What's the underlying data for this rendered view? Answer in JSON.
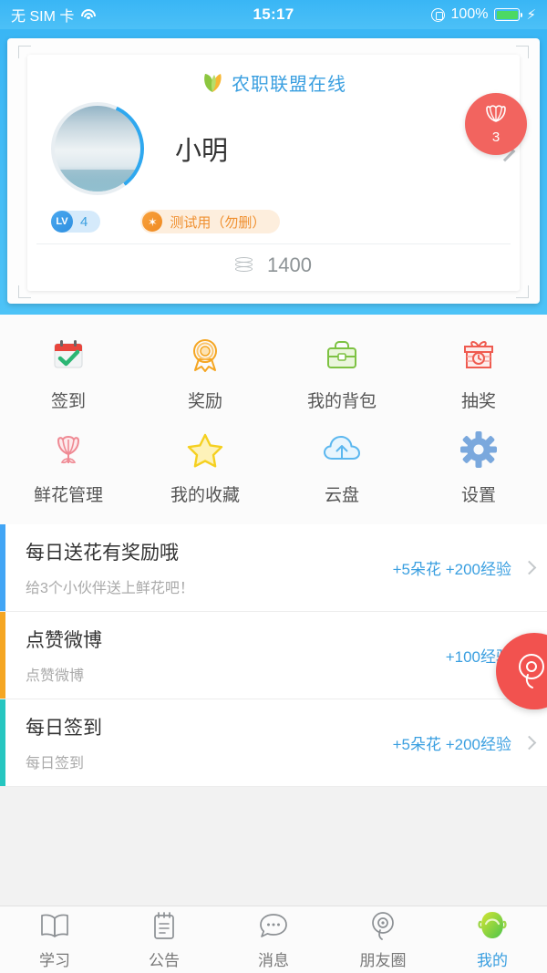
{
  "statusbar": {
    "carrier": "无 SIM 卡",
    "wifi_icon": "wifi-icon",
    "time": "15:17",
    "rotation_lock_icon": "rotation-lock-icon",
    "battery_percent": "100%",
    "battery_icon": "battery-icon",
    "charging_icon": "⚡"
  },
  "header": {
    "brand_logo_icon": "leaf-logo-icon",
    "brand_name": "农职联盟在线",
    "flower_badge": {
      "icon": "tulip-icon",
      "count": "3"
    },
    "avatar_icon": "user-avatar-photo",
    "user_name": "小明",
    "chevron_icon": "chevron-right-icon",
    "level": {
      "prefix": "LV",
      "value": "4"
    },
    "tag": {
      "icon": "star-icon",
      "label": "测试用（勿删）"
    },
    "coin": {
      "icon": "coin-stack-icon",
      "value": "1400"
    }
  },
  "grid": {
    "rows": [
      [
        {
          "icon": "calendar-check-icon",
          "label": "签到"
        },
        {
          "icon": "medal-icon",
          "label": "奖励"
        },
        {
          "icon": "backpack-icon",
          "label": "我的背包"
        },
        {
          "icon": "gift-box-icon",
          "label": "抽奖"
        }
      ],
      [
        {
          "icon": "rose-icon",
          "label": "鲜花管理"
        },
        {
          "icon": "star-outline-icon",
          "label": "我的收藏"
        },
        {
          "icon": "cloud-upload-icon",
          "label": "云盘"
        },
        {
          "icon": "gear-icon",
          "label": "设置"
        }
      ]
    ]
  },
  "tasks": [
    {
      "accent": "#42a5f5",
      "title": "每日送花有奖励哦",
      "subtitle": "给3个小伙伴送上鲜花吧！",
      "reward": "+5朵花 +200经验",
      "chevron_icon": "chevron-right-icon"
    },
    {
      "accent": "#f5a623",
      "title": "点赞微博",
      "subtitle": "点赞微博",
      "reward": "+100经验",
      "chevron_icon": "chevron-right-icon"
    },
    {
      "accent": "#26c6c0",
      "title": "每日签到",
      "subtitle": "每日签到",
      "reward": "+5朵花 +200经验",
      "chevron_icon": "chevron-right-icon"
    }
  ],
  "fab": {
    "icon": "flower-pin-icon"
  },
  "tabbar": {
    "items": [
      {
        "icon": "book-icon",
        "label": "学习",
        "active": false
      },
      {
        "icon": "clipboard-icon",
        "label": "公告",
        "active": false
      },
      {
        "icon": "chat-bubble-icon",
        "label": "消息",
        "active": false
      },
      {
        "icon": "friends-circle-icon",
        "label": "朋友圈",
        "active": false
      },
      {
        "icon": "profile-face-icon",
        "label": "我的",
        "active": true
      }
    ]
  },
  "colors": {
    "brand_blue": "#3a9fe0",
    "header_gradient_top": "#39b6f5",
    "accent_red": "#f2524f",
    "orange": "#f09030",
    "page_bg": "#f2f2f2"
  }
}
